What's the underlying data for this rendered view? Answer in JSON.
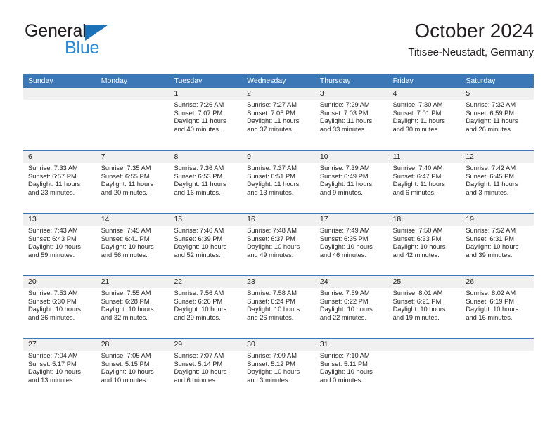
{
  "brand": {
    "word1": "General",
    "word2": "Blue",
    "triangle_color": "#1b72b8",
    "blue_color": "#2b8ad6"
  },
  "header": {
    "title": "October 2024",
    "subtitle": "Titisee-Neustadt, Germany",
    "header_bg": "#3b78b5",
    "band_bg": "#f0f0f0"
  },
  "weekdays": [
    "Sunday",
    "Monday",
    "Tuesday",
    "Wednesday",
    "Thursday",
    "Friday",
    "Saturday"
  ],
  "weeks": [
    [
      {
        "day": "",
        "sunrise": "",
        "sunset": "",
        "daylight_line1": "",
        "daylight_line2": ""
      },
      {
        "day": "",
        "sunrise": "",
        "sunset": "",
        "daylight_line1": "",
        "daylight_line2": ""
      },
      {
        "day": "1",
        "sunrise": "Sunrise: 7:26 AM",
        "sunset": "Sunset: 7:07 PM",
        "daylight_line1": "Daylight: 11 hours",
        "daylight_line2": "and 40 minutes."
      },
      {
        "day": "2",
        "sunrise": "Sunrise: 7:27 AM",
        "sunset": "Sunset: 7:05 PM",
        "daylight_line1": "Daylight: 11 hours",
        "daylight_line2": "and 37 minutes."
      },
      {
        "day": "3",
        "sunrise": "Sunrise: 7:29 AM",
        "sunset": "Sunset: 7:03 PM",
        "daylight_line1": "Daylight: 11 hours",
        "daylight_line2": "and 33 minutes."
      },
      {
        "day": "4",
        "sunrise": "Sunrise: 7:30 AM",
        "sunset": "Sunset: 7:01 PM",
        "daylight_line1": "Daylight: 11 hours",
        "daylight_line2": "and 30 minutes."
      },
      {
        "day": "5",
        "sunrise": "Sunrise: 7:32 AM",
        "sunset": "Sunset: 6:59 PM",
        "daylight_line1": "Daylight: 11 hours",
        "daylight_line2": "and 26 minutes."
      }
    ],
    [
      {
        "day": "6",
        "sunrise": "Sunrise: 7:33 AM",
        "sunset": "Sunset: 6:57 PM",
        "daylight_line1": "Daylight: 11 hours",
        "daylight_line2": "and 23 minutes."
      },
      {
        "day": "7",
        "sunrise": "Sunrise: 7:35 AM",
        "sunset": "Sunset: 6:55 PM",
        "daylight_line1": "Daylight: 11 hours",
        "daylight_line2": "and 20 minutes."
      },
      {
        "day": "8",
        "sunrise": "Sunrise: 7:36 AM",
        "sunset": "Sunset: 6:53 PM",
        "daylight_line1": "Daylight: 11 hours",
        "daylight_line2": "and 16 minutes."
      },
      {
        "day": "9",
        "sunrise": "Sunrise: 7:37 AM",
        "sunset": "Sunset: 6:51 PM",
        "daylight_line1": "Daylight: 11 hours",
        "daylight_line2": "and 13 minutes."
      },
      {
        "day": "10",
        "sunrise": "Sunrise: 7:39 AM",
        "sunset": "Sunset: 6:49 PM",
        "daylight_line1": "Daylight: 11 hours",
        "daylight_line2": "and 9 minutes."
      },
      {
        "day": "11",
        "sunrise": "Sunrise: 7:40 AM",
        "sunset": "Sunset: 6:47 PM",
        "daylight_line1": "Daylight: 11 hours",
        "daylight_line2": "and 6 minutes."
      },
      {
        "day": "12",
        "sunrise": "Sunrise: 7:42 AM",
        "sunset": "Sunset: 6:45 PM",
        "daylight_line1": "Daylight: 11 hours",
        "daylight_line2": "and 3 minutes."
      }
    ],
    [
      {
        "day": "13",
        "sunrise": "Sunrise: 7:43 AM",
        "sunset": "Sunset: 6:43 PM",
        "daylight_line1": "Daylight: 10 hours",
        "daylight_line2": "and 59 minutes."
      },
      {
        "day": "14",
        "sunrise": "Sunrise: 7:45 AM",
        "sunset": "Sunset: 6:41 PM",
        "daylight_line1": "Daylight: 10 hours",
        "daylight_line2": "and 56 minutes."
      },
      {
        "day": "15",
        "sunrise": "Sunrise: 7:46 AM",
        "sunset": "Sunset: 6:39 PM",
        "daylight_line1": "Daylight: 10 hours",
        "daylight_line2": "and 52 minutes."
      },
      {
        "day": "16",
        "sunrise": "Sunrise: 7:48 AM",
        "sunset": "Sunset: 6:37 PM",
        "daylight_line1": "Daylight: 10 hours",
        "daylight_line2": "and 49 minutes."
      },
      {
        "day": "17",
        "sunrise": "Sunrise: 7:49 AM",
        "sunset": "Sunset: 6:35 PM",
        "daylight_line1": "Daylight: 10 hours",
        "daylight_line2": "and 46 minutes."
      },
      {
        "day": "18",
        "sunrise": "Sunrise: 7:50 AM",
        "sunset": "Sunset: 6:33 PM",
        "daylight_line1": "Daylight: 10 hours",
        "daylight_line2": "and 42 minutes."
      },
      {
        "day": "19",
        "sunrise": "Sunrise: 7:52 AM",
        "sunset": "Sunset: 6:31 PM",
        "daylight_line1": "Daylight: 10 hours",
        "daylight_line2": "and 39 minutes."
      }
    ],
    [
      {
        "day": "20",
        "sunrise": "Sunrise: 7:53 AM",
        "sunset": "Sunset: 6:30 PM",
        "daylight_line1": "Daylight: 10 hours",
        "daylight_line2": "and 36 minutes."
      },
      {
        "day": "21",
        "sunrise": "Sunrise: 7:55 AM",
        "sunset": "Sunset: 6:28 PM",
        "daylight_line1": "Daylight: 10 hours",
        "daylight_line2": "and 32 minutes."
      },
      {
        "day": "22",
        "sunrise": "Sunrise: 7:56 AM",
        "sunset": "Sunset: 6:26 PM",
        "daylight_line1": "Daylight: 10 hours",
        "daylight_line2": "and 29 minutes."
      },
      {
        "day": "23",
        "sunrise": "Sunrise: 7:58 AM",
        "sunset": "Sunset: 6:24 PM",
        "daylight_line1": "Daylight: 10 hours",
        "daylight_line2": "and 26 minutes."
      },
      {
        "day": "24",
        "sunrise": "Sunrise: 7:59 AM",
        "sunset": "Sunset: 6:22 PM",
        "daylight_line1": "Daylight: 10 hours",
        "daylight_line2": "and 22 minutes."
      },
      {
        "day": "25",
        "sunrise": "Sunrise: 8:01 AM",
        "sunset": "Sunset: 6:21 PM",
        "daylight_line1": "Daylight: 10 hours",
        "daylight_line2": "and 19 minutes."
      },
      {
        "day": "26",
        "sunrise": "Sunrise: 8:02 AM",
        "sunset": "Sunset: 6:19 PM",
        "daylight_line1": "Daylight: 10 hours",
        "daylight_line2": "and 16 minutes."
      }
    ],
    [
      {
        "day": "27",
        "sunrise": "Sunrise: 7:04 AM",
        "sunset": "Sunset: 5:17 PM",
        "daylight_line1": "Daylight: 10 hours",
        "daylight_line2": "and 13 minutes."
      },
      {
        "day": "28",
        "sunrise": "Sunrise: 7:05 AM",
        "sunset": "Sunset: 5:15 PM",
        "daylight_line1": "Daylight: 10 hours",
        "daylight_line2": "and 10 minutes."
      },
      {
        "day": "29",
        "sunrise": "Sunrise: 7:07 AM",
        "sunset": "Sunset: 5:14 PM",
        "daylight_line1": "Daylight: 10 hours",
        "daylight_line2": "and 6 minutes."
      },
      {
        "day": "30",
        "sunrise": "Sunrise: 7:09 AM",
        "sunset": "Sunset: 5:12 PM",
        "daylight_line1": "Daylight: 10 hours",
        "daylight_line2": "and 3 minutes."
      },
      {
        "day": "31",
        "sunrise": "Sunrise: 7:10 AM",
        "sunset": "Sunset: 5:11 PM",
        "daylight_line1": "Daylight: 10 hours",
        "daylight_line2": "and 0 minutes."
      },
      {
        "day": "",
        "sunrise": "",
        "sunset": "",
        "daylight_line1": "",
        "daylight_line2": ""
      },
      {
        "day": "",
        "sunrise": "",
        "sunset": "",
        "daylight_line1": "",
        "daylight_line2": ""
      }
    ]
  ]
}
